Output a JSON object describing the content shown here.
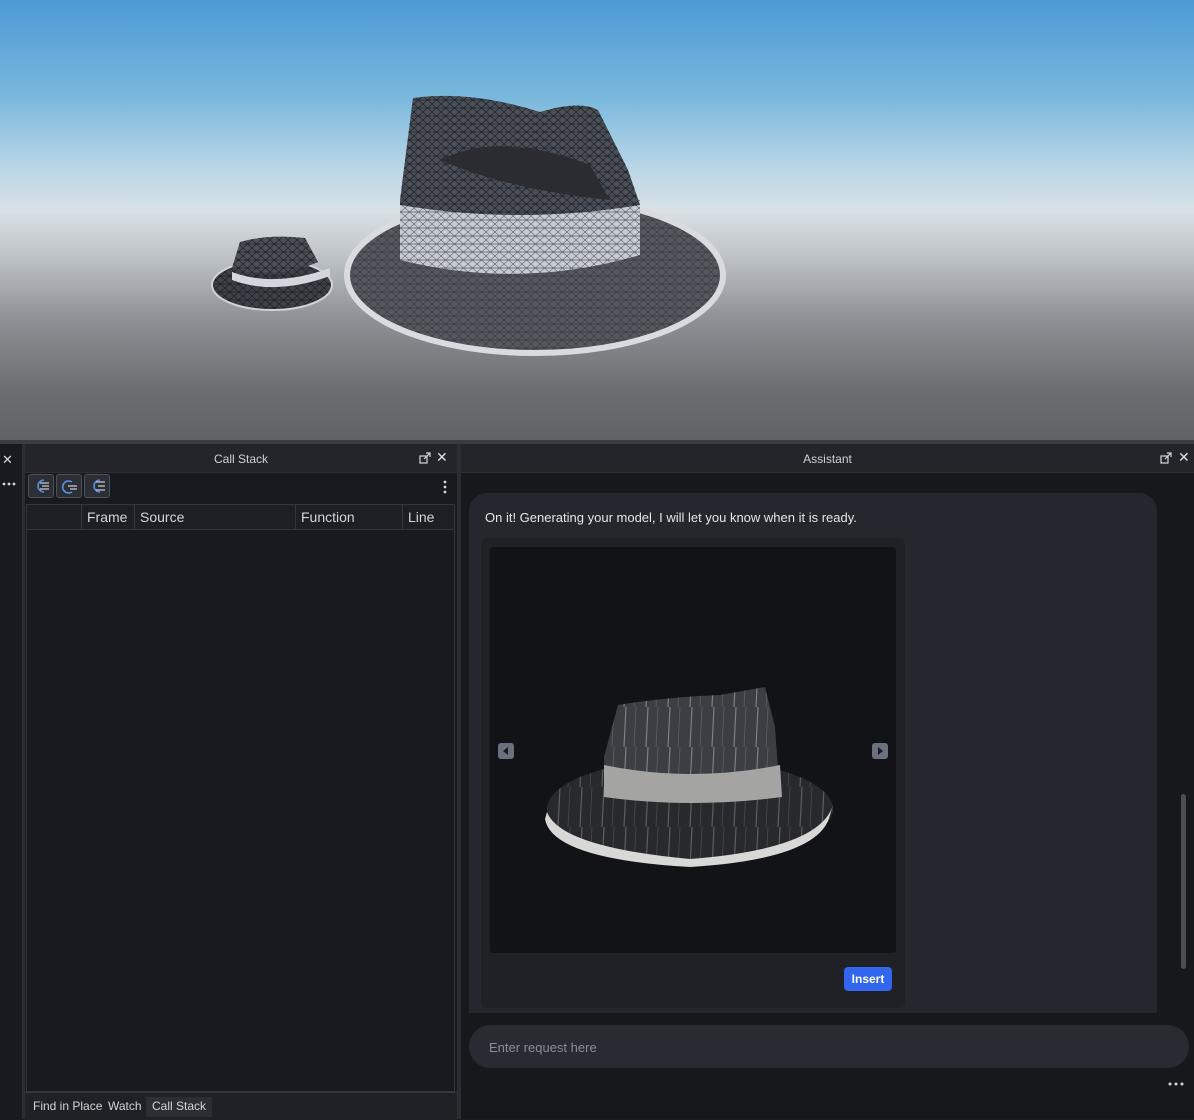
{
  "viewport": {
    "scene": "3D viewport with two wireframe fedora hat models"
  },
  "left_panel": {
    "close_icon": "✕"
  },
  "call_stack": {
    "title": "Call Stack",
    "close_icon": "✕",
    "columns": [
      "",
      "Frame",
      "Source",
      "Function",
      "Line"
    ],
    "rows": [],
    "bottom_tabs": [
      "Find in Place",
      "Watch",
      "Call Stack"
    ],
    "active_tab": "Call Stack"
  },
  "assistant": {
    "title": "Assistant",
    "close_icon": "✕",
    "message": "On it! Generating your model, I will let you know when it is ready.",
    "insert_label": "Insert",
    "input_placeholder": "Enter request here"
  },
  "colors": {
    "accent": "#3366ee",
    "panel_bg": "#191a1f",
    "bubble_bg": "#25272e"
  }
}
